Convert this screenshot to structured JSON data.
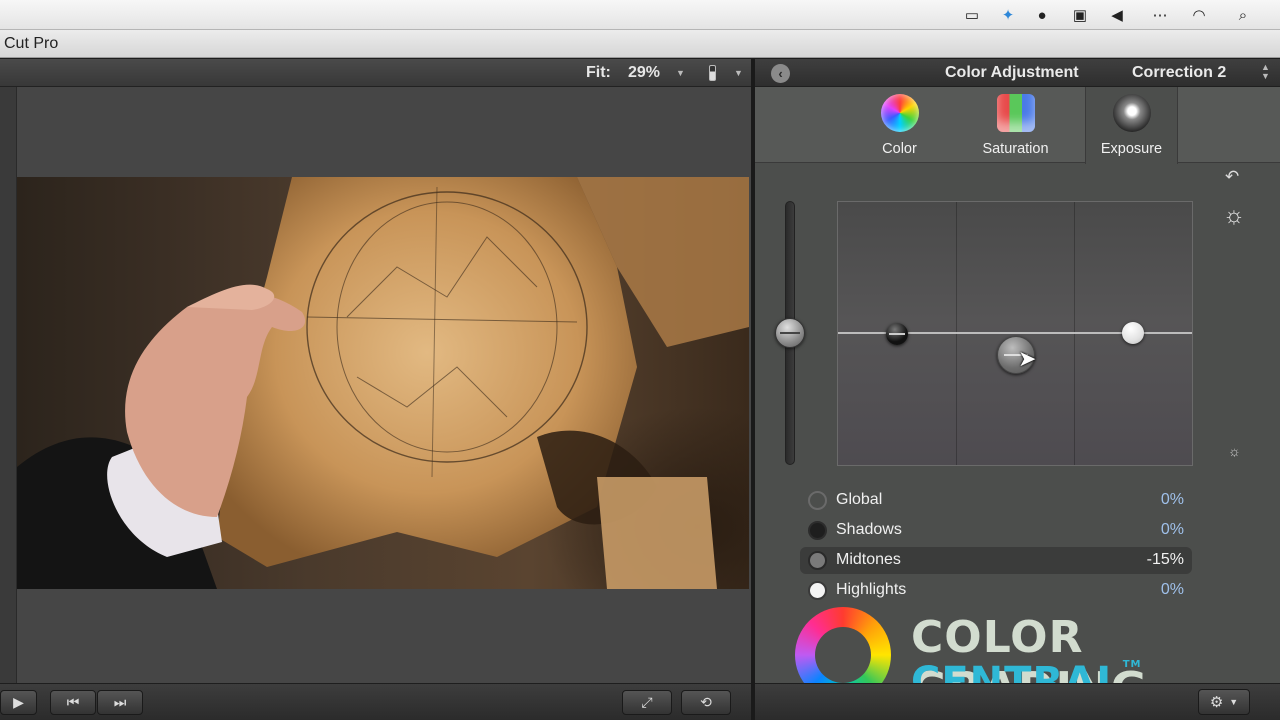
{
  "app": {
    "title": "Cut Pro"
  },
  "menubar": {
    "icons": [
      "facetime-camera-icon",
      "dropbox-icon",
      "screen-recorder-icon",
      "display-icon",
      "volume-icon",
      "more-icon",
      "wifi-icon",
      "spotlight-search-icon"
    ]
  },
  "viewer": {
    "fit_label": "Fit:",
    "fit_value": "29%"
  },
  "inspector": {
    "title": "Color Adjustment",
    "correction": "Correction 2",
    "tabs": [
      {
        "label": "Color",
        "icon": "color-wheel-icon"
      },
      {
        "label": "Saturation",
        "icon": "saturation-bars-icon"
      },
      {
        "label": "Exposure",
        "icon": "exposure-sphere-icon",
        "selected": true
      }
    ],
    "parameters": [
      {
        "name": "Global",
        "value": "0%"
      },
      {
        "name": "Shadows",
        "value": "0%"
      },
      {
        "name": "Midtones",
        "value": "-15%",
        "selected": true
      },
      {
        "name": "Highlights",
        "value": "0%"
      }
    ]
  },
  "watermark": {
    "line1": "COLOR GRADING",
    "line2": "CENTRAL",
    "tm": "TM"
  },
  "colors": {
    "inspector_bg": "#4c4e4c",
    "value_blue": "#9fc0ea",
    "logo_cyan": "#2fb8d6"
  }
}
